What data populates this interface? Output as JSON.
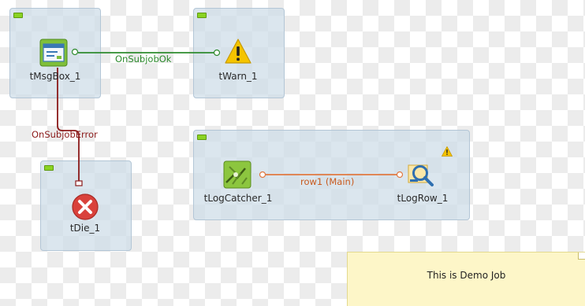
{
  "components": {
    "msgbox": {
      "label": "tMsgBox_1"
    },
    "warn": {
      "label": "tWarn_1"
    },
    "die": {
      "label": "tDie_1"
    },
    "logcatcher": {
      "label": "tLogCatcher_1"
    },
    "logrow": {
      "label": "tLogRow_1"
    }
  },
  "links": {
    "ok": {
      "label": "OnSubjobOk"
    },
    "error": {
      "label": "OnSubjobError"
    },
    "main": {
      "label": "row1 (Main)"
    }
  },
  "note": {
    "text": "This is Demo Job"
  },
  "colors": {
    "ok_link": "#2e8b2e",
    "error_link": "#8b1a1a",
    "main_link": "#e07840"
  }
}
